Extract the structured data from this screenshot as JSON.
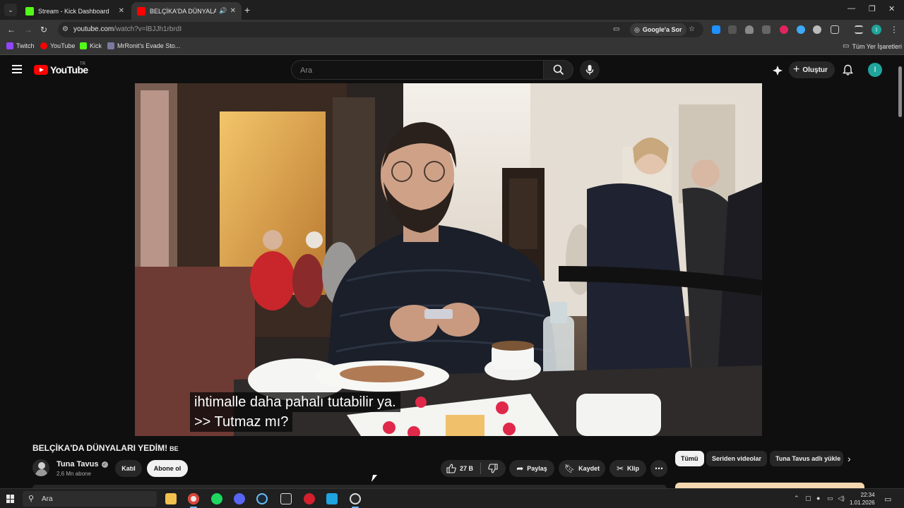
{
  "browser": {
    "tabs": [
      {
        "title": "Stream - Kick Dashboard",
        "favicon_color": "#53fc18"
      },
      {
        "title": "BELÇİKA'DA DÜNYALARI YE",
        "favicon_color": "#ff0000"
      }
    ],
    "url_main": "youtube.com",
    "url_path": "/watch?v=lBJJh1rbrdI",
    "google_sor": "Google'a Sor",
    "bookmarks": [
      {
        "label": "Twitch",
        "color": "#9146ff"
      },
      {
        "label": "YouTube",
        "color": "#ff0000"
      },
      {
        "label": "Kick",
        "color": "#53fc18"
      },
      {
        "label": "MrRonit's Evade Sto...",
        "color": "#7a7aa0"
      }
    ],
    "all_bookmarks": "Tüm Yer İşaretleri",
    "profile_initial": "I"
  },
  "youtube": {
    "logo_text": "YouTube",
    "country": "TR",
    "search_placeholder": "Ara",
    "create_label": "Oluştur",
    "avatar_initial": "I"
  },
  "video": {
    "subtitle_line1": "ihtimalle daha pahalı tutabilir ya.",
    "subtitle_line2": ">> Tutmaz mı?",
    "title": "BELÇİKA'DA DÜNYALARI YEDİM!",
    "title_flag": "BE",
    "channel_name": "Tuna Tavus",
    "subscribers": "2,6 Mn abone",
    "join_label": "Katıl",
    "subscribe_label": "Abone ol",
    "likes": "27 B",
    "share_label": "Paylaş",
    "save_label": "Kaydet",
    "clip_label": "Klip"
  },
  "chips": [
    "Tümü",
    "Seriden videolar",
    "Tuna Tavus adlı yükle"
  ],
  "taskbar": {
    "search_placeholder": "Ara",
    "time": "22:34",
    "date": "1.01.2026"
  }
}
